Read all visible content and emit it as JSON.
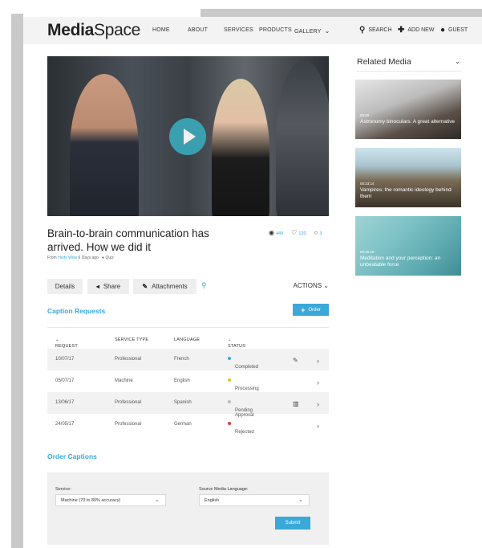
{
  "header": {
    "logo_bold": "Media",
    "logo_light": "Space",
    "nav": [
      "HOME",
      "ABOUT",
      "SERVICES",
      "PRODUCTS",
      "GALLERY"
    ],
    "search_label": "SEARCH",
    "add_new_label": "ADD NEW",
    "guest_label": "GUEST"
  },
  "media": {
    "title": "Brain-to-brain communication has arrived. How we did it",
    "meta_from": "From",
    "meta_user": "Hedy Wow",
    "meta_time": "6 Days ago",
    "meta_tag": "Quiz",
    "views": "449",
    "likes": "120",
    "comments": "3"
  },
  "tabs": {
    "details": "Details",
    "share": "Share",
    "attachments": "Attachments",
    "actions": "ACTIONS"
  },
  "caption_requests": {
    "title": "Caption Requests",
    "order_label": "Order",
    "columns": [
      "REQUEST DATE",
      "SERVICE TYPE",
      "LANGUAGE",
      "STATUS"
    ],
    "rows": [
      {
        "date": "10/07/17",
        "service": "Professional",
        "language": "French",
        "status": "Completed",
        "status_color": "#3aa8d8"
      },
      {
        "date": "05/07/17",
        "service": "Machine",
        "language": "English",
        "status": "Processing",
        "status_color": "#f2c21b"
      },
      {
        "date": "13/06/17",
        "service": "Professional",
        "language": "Spanish",
        "status": "Pending Approval",
        "status_color": "#bdbdbd"
      },
      {
        "date": "24/05/17",
        "service": "Professional",
        "language": "German",
        "status": "Rejected",
        "status_color": "#e0393e"
      }
    ]
  },
  "order_captions": {
    "title": "Order Captions",
    "service_label": "Service:",
    "service_value": "Machine (70 to 80% accuracy)",
    "language_label": "Source Media Language:",
    "language_value": "English",
    "submit_label": "Submit"
  },
  "related": {
    "title": "Related Media",
    "items": [
      {
        "duration": "00:59",
        "caption": "Astronomy binoculars: A great alternative"
      },
      {
        "duration": "00:23:14",
        "caption": "Vampires: the romantic ideology behind them"
      },
      {
        "duration": "00:45:18",
        "caption": "Meditation and your perception: an unbeatable force"
      }
    ]
  },
  "colors": {
    "accent": "#3aa8d8",
    "play": "#3aa8b8"
  }
}
